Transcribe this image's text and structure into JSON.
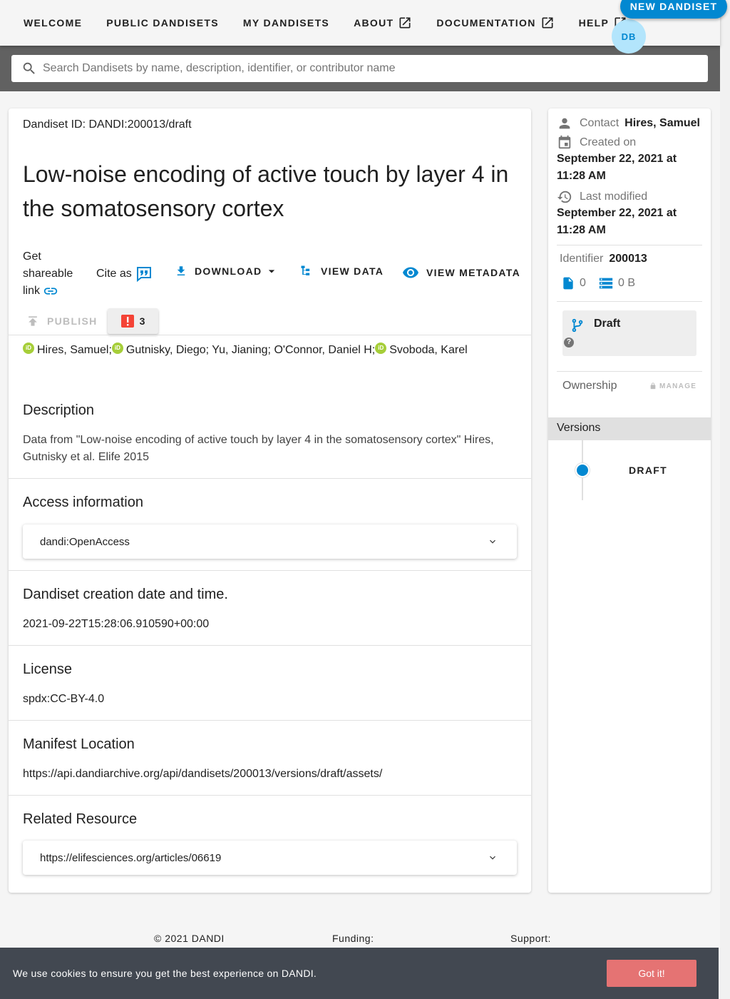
{
  "nav": {
    "welcome": "WELCOME",
    "public": "PUBLIC DANDISETS",
    "my": "MY DANDISETS",
    "about": "ABOUT",
    "docs": "DOCUMENTATION",
    "help": "HELP",
    "new_dandiset": "NEW DANDISET",
    "avatar_initials": "DB"
  },
  "search": {
    "placeholder": "Search Dandisets by name, description, identifier, or contributor name"
  },
  "dandiset": {
    "id_label": "Dandiset ID: DANDI:200013/draft",
    "title": "Low-noise encoding of active touch by layer 4 in the somatosensory cortex",
    "share_label": "Get shareable link",
    "cite_label": "Cite as",
    "download_label": "DOWNLOAD",
    "view_data_label": "VIEW DATA",
    "view_metadata_label": "VIEW METADATA",
    "publish_label": "PUBLISH",
    "error_count": "3",
    "contributors": [
      "Hires, Samuel;",
      "Gutnisky, Diego; Yu, Jianing; O'Connor, Daniel H;",
      "Svoboda, Karel"
    ]
  },
  "sections": {
    "description_h": "Description",
    "description_t": "Data from \"Low-noise encoding of active touch by layer 4 in the somatosensory cortex\" Hires, Gutnisky et al. Elife 2015",
    "access_h": "Access information",
    "access_value": "dandi:OpenAccess",
    "created_h": "Dandiset creation date and time.",
    "created_t": "2021-09-22T15:28:06.910590+00:00",
    "license_h": "License",
    "license_t": "spdx:CC-BY-4.0",
    "manifest_h": "Manifest Location",
    "manifest_t": "https://api.dandiarchive.org/api/dandisets/200013/versions/draft/assets/",
    "related_h": "Related Resource",
    "related_value": "https://elifesciences.org/articles/06619"
  },
  "side": {
    "contact_label": "Contact",
    "contact_name": "Hires, Samuel",
    "created_label": "Created on",
    "created_date": "September 22, 2021 at 11:28 AM",
    "modified_label": "Last modified",
    "modified_date": "September 22, 2021 at 11:28 AM",
    "identifier_label": "Identifier",
    "identifier_value": "200013",
    "file_count": "0",
    "size": "0 B",
    "draft_label": "Draft",
    "ownership_label": "Ownership",
    "manage_label": "MANAGE",
    "versions_label": "Versions",
    "version_item": "DRAFT"
  },
  "footer": {
    "copyright": "© 2021 DANDI",
    "funding": "Funding:",
    "support": "Support:"
  },
  "cookie": {
    "message": "We use cookies to ensure you get the best experience on DANDI.",
    "button": "Got it!"
  },
  "colors": {
    "accent": "#0288d1",
    "orcid": "#a6ce39",
    "error": "#f44336",
    "cookie_bg": "#424851",
    "cookie_btn": "#e57373"
  }
}
